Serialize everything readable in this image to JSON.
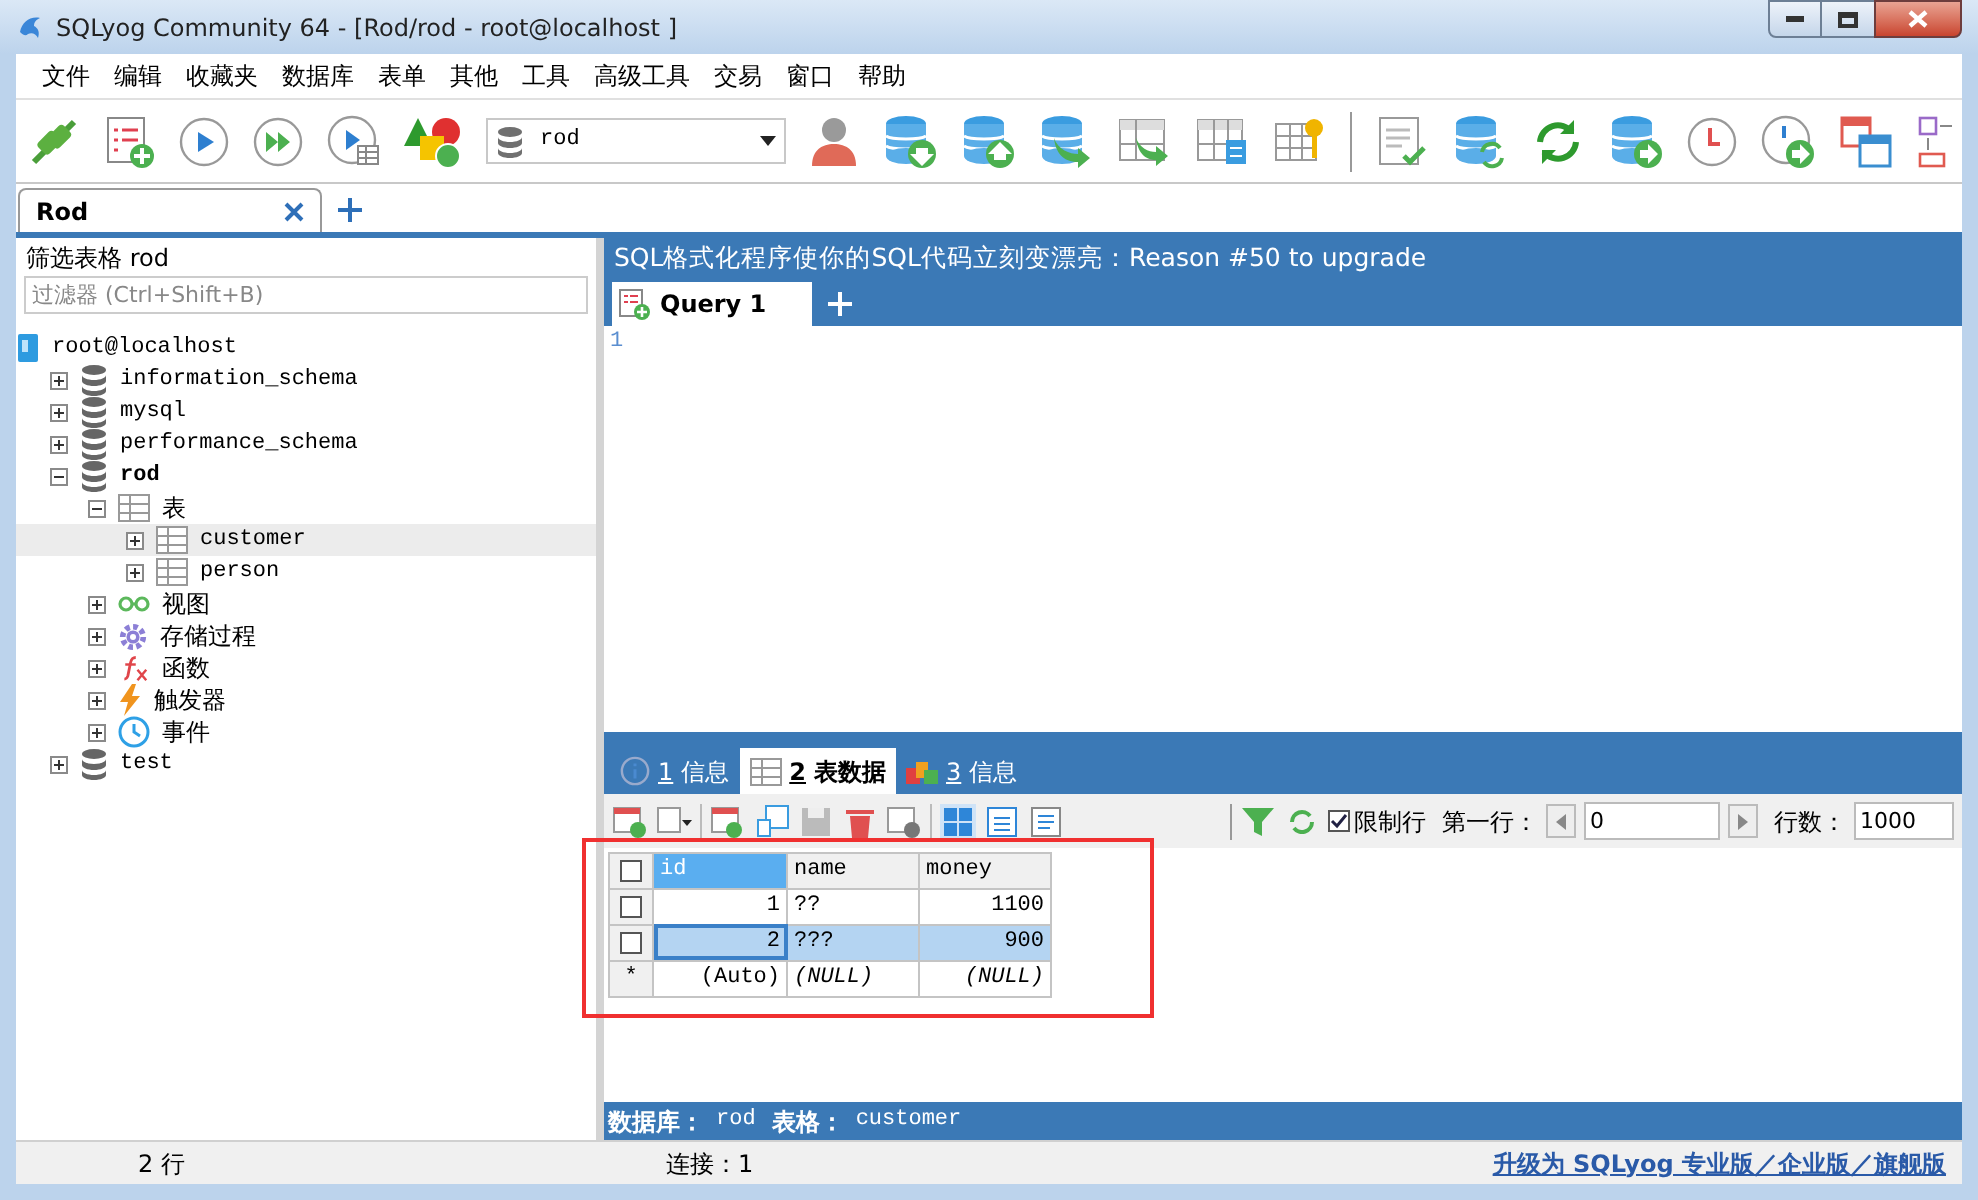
{
  "window": {
    "title": "SQLyog Community 64 - [Rod/rod - root@localhost ]"
  },
  "menu": [
    "文件",
    "编辑",
    "收藏夹",
    "数据库",
    "表单",
    "其他",
    "工具",
    "高级工具",
    "交易",
    "窗口",
    "帮助"
  ],
  "toolbar": {
    "database_select": {
      "value": "rod"
    }
  },
  "connection_tabs": [
    {
      "label": "Rod",
      "selected": true
    }
  ],
  "sidebar": {
    "title": "筛选表格 rod",
    "filter": {
      "placeholder": "过滤器 (Ctrl+Shift+B)"
    },
    "tree": [
      {
        "kind": "server",
        "label": "root@localhost",
        "children": [
          {
            "kind": "database",
            "label": "information_schema",
            "expanded": false,
            "active": false
          },
          {
            "kind": "database",
            "label": "mysql",
            "expanded": false,
            "active": false
          },
          {
            "kind": "database",
            "label": "performance_schema",
            "expanded": false,
            "active": false
          },
          {
            "kind": "database",
            "label": "rod",
            "expanded": true,
            "active": true,
            "children": [
              {
                "kind": "tables",
                "label": "表",
                "expanded": true,
                "children": [
                  {
                    "kind": "table",
                    "label": "customer",
                    "expanded": false,
                    "selected": true
                  },
                  {
                    "kind": "table",
                    "label": "person",
                    "expanded": false,
                    "selected": false
                  }
                ]
              },
              {
                "kind": "views",
                "label": "视图",
                "expanded": false
              },
              {
                "kind": "procedures",
                "label": "存储过程",
                "expanded": false
              },
              {
                "kind": "functions",
                "label": "函数",
                "expanded": false
              },
              {
                "kind": "triggers",
                "label": "触发器",
                "expanded": false
              },
              {
                "kind": "events",
                "label": "事件",
                "expanded": false
              }
            ]
          },
          {
            "kind": "database",
            "label": "test",
            "expanded": false,
            "active": false
          }
        ]
      }
    ]
  },
  "banner": "SQL格式化程序使你的SQL代码立刻变漂亮：Reason #50 to upgrade",
  "query_tabs": [
    {
      "label": "Query 1",
      "selected": true
    }
  ],
  "editor": {
    "line_numbers": [
      "1"
    ]
  },
  "result_tabs": [
    {
      "number": "1",
      "label": "信息",
      "kind": "info",
      "selected": false
    },
    {
      "number": "2",
      "label": "表数据",
      "kind": "table",
      "selected": true
    },
    {
      "number": "3",
      "label": "信息",
      "kind": "blocks",
      "selected": false
    }
  ],
  "result_toolbar": {
    "limit_rows": {
      "label": "限制行",
      "checked": true
    },
    "first_row": {
      "label": "第一行：",
      "value": "0"
    },
    "row_count": {
      "label": "行数：",
      "value": "1000"
    }
  },
  "grid": {
    "select_all": {
      "checked": false
    },
    "columns": [
      {
        "label": "id",
        "selected": true
      },
      {
        "label": "name",
        "selected": false
      },
      {
        "label": "money",
        "selected": false
      }
    ],
    "rows": [
      {
        "checked": false,
        "selected": false,
        "cells": [
          "1",
          "??",
          "1100"
        ]
      },
      {
        "checked": false,
        "selected": true,
        "cells": [
          "2",
          "???",
          "900"
        ]
      },
      {
        "marker": "*",
        "selected": false,
        "new_row": true,
        "cells": [
          "(Auto)",
          "(NULL)",
          "(NULL)"
        ]
      }
    ]
  },
  "info_bar": {
    "database_label": "数据库：",
    "database": "rod",
    "table_label": "表格：",
    "table": "customer"
  },
  "status_bar": {
    "rows": "2 行",
    "connection": "连接：1",
    "upgrade_link": "升级为 SQLyog 专业版／企业版／旗舰版"
  }
}
